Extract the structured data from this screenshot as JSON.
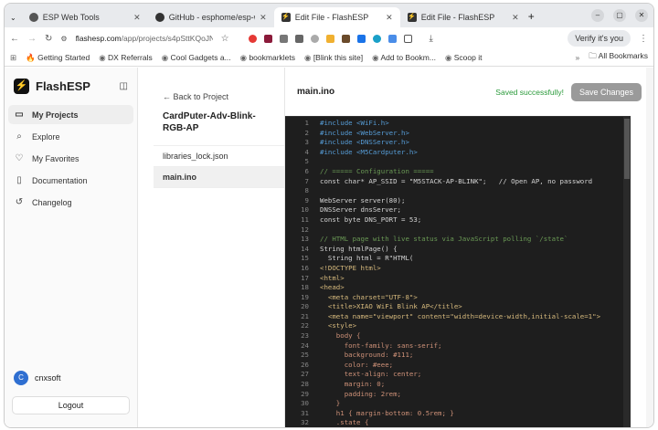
{
  "browser": {
    "tabs": [
      {
        "title": "ESP Web Tools",
        "active": false
      },
      {
        "title": "GitHub - esphome/esp-w",
        "active": false
      },
      {
        "title": "Edit File - FlashESP",
        "active": true
      },
      {
        "title": "Edit File - FlashESP",
        "active": false
      }
    ],
    "url_host": "flashesp.com",
    "url_path": "/app/projects/s4pSttKQoJNQQc6Dra0mR/files/tpz...",
    "verify": "Verify it's you",
    "bookmarks": [
      "Getting Started",
      "DX Referrals",
      "Cool Gadgets a...",
      "bookmarklets",
      "[Blink this site]",
      "Add to Bookm...",
      "Scoop it"
    ],
    "all_bookmarks": "All Bookmarks"
  },
  "sidebar": {
    "brand": "FlashESP",
    "items": [
      {
        "label": "My Projects",
        "icon": "folder-icon"
      },
      {
        "label": "Explore",
        "icon": "search-icon"
      },
      {
        "label": "My Favorites",
        "icon": "heart-icon"
      },
      {
        "label": "Documentation",
        "icon": "book-icon"
      },
      {
        "label": "Changelog",
        "icon": "history-icon"
      }
    ],
    "user_initial": "C",
    "user": "cnxsoft",
    "logout": "Logout"
  },
  "files": {
    "back": "Back to Project",
    "project": "CardPuter-Adv-Blink-RGB-AP",
    "list": [
      "libraries_lock.json",
      "main.ino"
    ]
  },
  "editor": {
    "filename": "main.ino",
    "status": "Saved successfully!",
    "save": "Save Changes",
    "lines": [
      "#include <WiFi.h>",
      "#include <WebServer.h>",
      "#include <DNSServer.h>",
      "#include <M5Cardputer.h>",
      "",
      "// ===== Configuration =====",
      "const char* AP_SSID = \"M5STACK-AP-BLINK\";   // Open AP, no password",
      "",
      "WebServer server(80);",
      "DNSServer dnsServer;",
      "const byte DNS_PORT = 53;",
      "",
      "// HTML page with live status via JavaScript polling `/state`",
      "String htmlPage() {",
      "  String html = R\"HTML(",
      "<!DOCTYPE html>",
      "<html>",
      "<head>",
      "  <meta charset=\"UTF-8\">",
      "  <title>XIAO WiFi Blink AP</title>",
      "  <meta name=\"viewport\" content=\"width=device-width,initial-scale=1\">",
      "  <style>",
      "    body {",
      "      font-family: sans-serif;",
      "      background: #111;",
      "      color: #eee;",
      "      text-align: center;",
      "      margin: 0;",
      "      padding: 2rem;",
      "    }",
      "    h1 { margin-bottom: 0.5rem; }",
      "    .state {"
    ]
  }
}
